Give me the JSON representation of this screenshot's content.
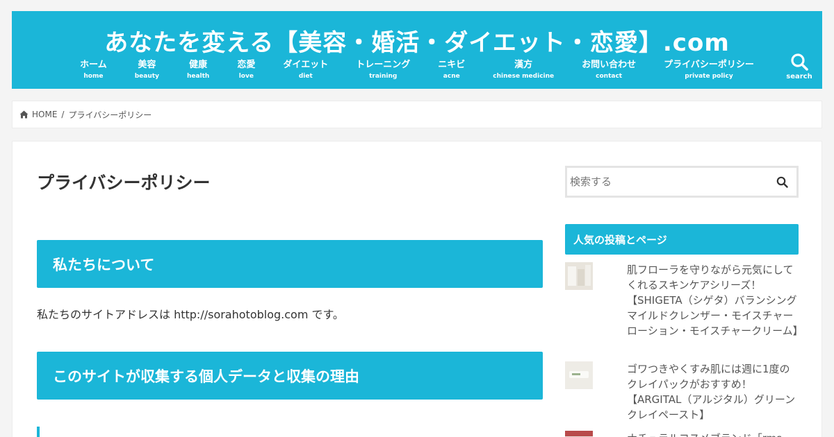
{
  "site": {
    "title": "あなたを変える【美容・婚活・ダイエット・恋愛】.com"
  },
  "nav": [
    {
      "label": "ホーム",
      "sub": "home"
    },
    {
      "label": "美容",
      "sub": "beauty"
    },
    {
      "label": "健康",
      "sub": "health"
    },
    {
      "label": "恋愛",
      "sub": "love"
    },
    {
      "label": "ダイエット",
      "sub": "diet"
    },
    {
      "label": "トレーニング",
      "sub": "training"
    },
    {
      "label": "ニキビ",
      "sub": "acne"
    },
    {
      "label": "漢方",
      "sub": "chinese medicine"
    },
    {
      "label": "お問い合わせ",
      "sub": "contact"
    },
    {
      "label": "プライバシーポリシー",
      "sub": "private policy"
    }
  ],
  "header_search": {
    "label": "search",
    "icon": "search-icon"
  },
  "breadcrumb": {
    "home": "HOME",
    "separator": "/",
    "current": "プライバシーポリシー"
  },
  "page": {
    "title": "プライバシーポリシー",
    "section1_heading": "私たちについて",
    "section1_text": "私たちのサイトアドレスは http://sorahotoblog.com です。",
    "section2_heading": "このサイトが収集する個人データと収集の理由"
  },
  "sidebar": {
    "search_placeholder": "検索する",
    "popular_title": "人気の投稿とページ",
    "posts": [
      {
        "title": "肌フローラを守りながら元気にしてくれるスキンケアシリーズ！【SHIGETA（シゲタ）バランシングマイルドクレンザー・モイスチャーローション・モイスチャークリーム】"
      },
      {
        "title": "ゴワつきやくすみ肌には週に1度のクレイパックがおすすめ！【ARGITAL（アルジタル）グリーンクレイペースト】"
      },
      {
        "title": "ナチュラルコスメブランド「rms"
      }
    ]
  },
  "colors": {
    "accent": "#1bb6d8",
    "background": "#f4f4f4"
  }
}
